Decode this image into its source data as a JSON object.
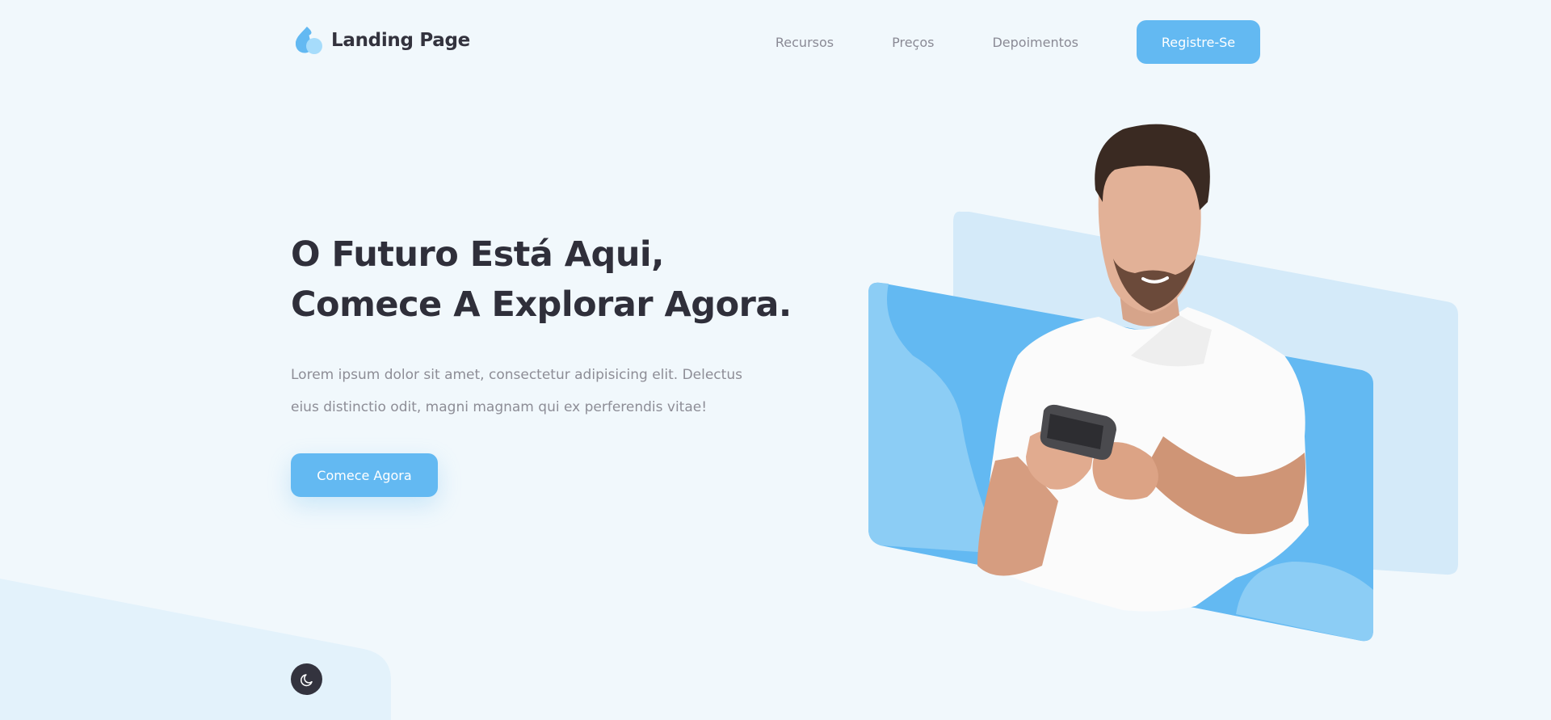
{
  "brand": {
    "name": "Landing Page"
  },
  "nav": {
    "links": [
      "Recursos",
      "Preços",
      "Depoimentos"
    ],
    "cta_label": "Registre-Se"
  },
  "hero": {
    "title_line1": "O Futuro Está Aqui,",
    "title_line2": "Comece A Explorar Agora.",
    "description_line1": "Lorem ipsum dolor sit amet, consectetur adipisicing elit. Delectus",
    "description_line2": "eius distinctio odit, magni magnam qui ex perferendis vitae!",
    "cta_label": "Comece Agora"
  },
  "icons": {
    "logo": "water-drop-icon",
    "theme": "moon-icon"
  },
  "colors": {
    "accent": "#63b9f2",
    "dark": "#33333e",
    "background": "#f1f8fc"
  }
}
